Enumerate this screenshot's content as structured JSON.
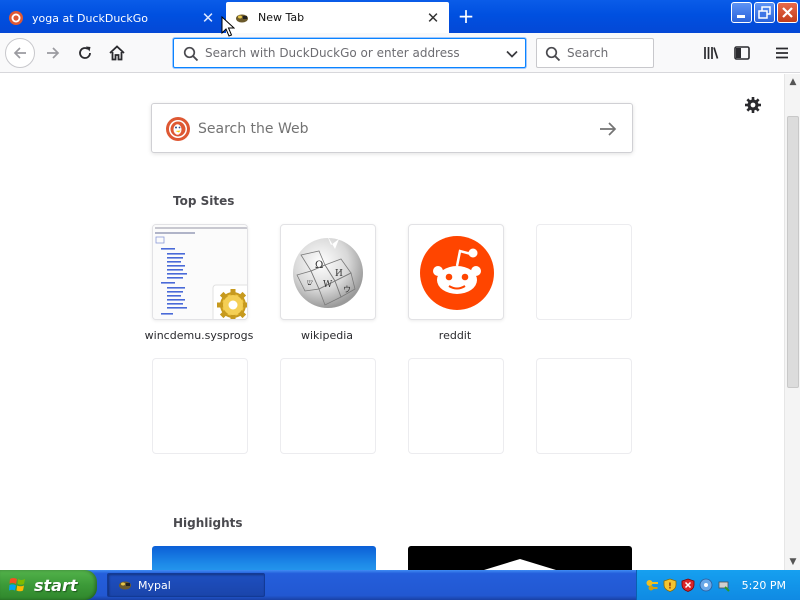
{
  "tabs": [
    {
      "title": "yoga at DuckDuckGo",
      "favicon": "duckduckgo-icon",
      "active": false
    },
    {
      "title": "New Tab",
      "favicon": "new-tab-icon",
      "active": true
    }
  ],
  "toolbar": {
    "url_placeholder": "Search with DuckDuckGo or enter address",
    "search_placeholder": "Search"
  },
  "newtab": {
    "web_search_placeholder": "Search the Web",
    "top_sites_title": "Top Sites",
    "top_sites": [
      {
        "label": "wincdemu.sysprogs",
        "icon": "wincdemu-thumbnail"
      },
      {
        "label": "wikipedia",
        "icon": "wikipedia-icon"
      },
      {
        "label": "reddit",
        "icon": "reddit-icon"
      },
      {
        "label": "",
        "icon": ""
      },
      {
        "label": "",
        "icon": ""
      },
      {
        "label": "",
        "icon": ""
      },
      {
        "label": "",
        "icon": ""
      },
      {
        "label": "",
        "icon": ""
      }
    ],
    "highlights_title": "Highlights"
  },
  "taskbar": {
    "start_label": "start",
    "window_label": "Mypal",
    "clock": "5:20 PM"
  },
  "colors": {
    "accent": "#0a84ff",
    "reddit": "#ff4500",
    "duckduckgo": "#de5833",
    "xp_blue": "#245edb",
    "xp_green": "#3c9a38"
  }
}
